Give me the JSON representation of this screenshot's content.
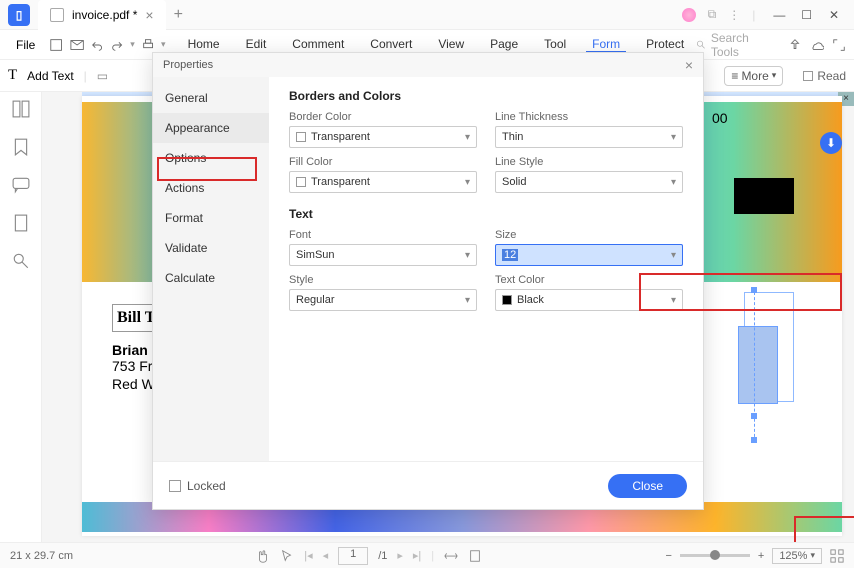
{
  "titlebar": {
    "tab_name": "invoice.pdf *"
  },
  "menubar": {
    "file": "File",
    "menus": [
      "Home",
      "Edit",
      "Comment",
      "Convert",
      "View",
      "Page",
      "Tool",
      "Form",
      "Protect"
    ],
    "active": "Form",
    "search_placeholder": "Search Tools"
  },
  "secbar": {
    "addtext": "Add Text",
    "more": "More",
    "read": "Read"
  },
  "dialog": {
    "title": "Properties",
    "sidebar": [
      "General",
      "Appearance",
      "Options",
      "Actions",
      "Format",
      "Validate",
      "Calculate"
    ],
    "active_sidebar": "Appearance",
    "section1": "Borders and Colors",
    "section2": "Text",
    "border_color_lbl": "Border Color",
    "border_color_val": "Transparent",
    "line_thickness_lbl": "Line Thickness",
    "line_thickness_val": "Thin",
    "fill_color_lbl": "Fill Color",
    "fill_color_val": "Transparent",
    "line_style_lbl": "Line Style",
    "line_style_val": "Solid",
    "font_lbl": "Font",
    "font_val": "SimSun",
    "size_lbl": "Size",
    "size_val": "12",
    "style_lbl": "Style",
    "style_val": "Regular",
    "text_color_lbl": "Text Color",
    "text_color_val": "Black",
    "locked": "Locked",
    "close": "Close"
  },
  "document": {
    "charges_amt": "00",
    "billto": "Bill T",
    "name": "Brian",
    "addr1": "753 Fr",
    "addr2": "Red W"
  },
  "status": {
    "dimensions": "21 x 29.7 cm",
    "page": "1",
    "pages": "/1",
    "zoom": "125%"
  }
}
